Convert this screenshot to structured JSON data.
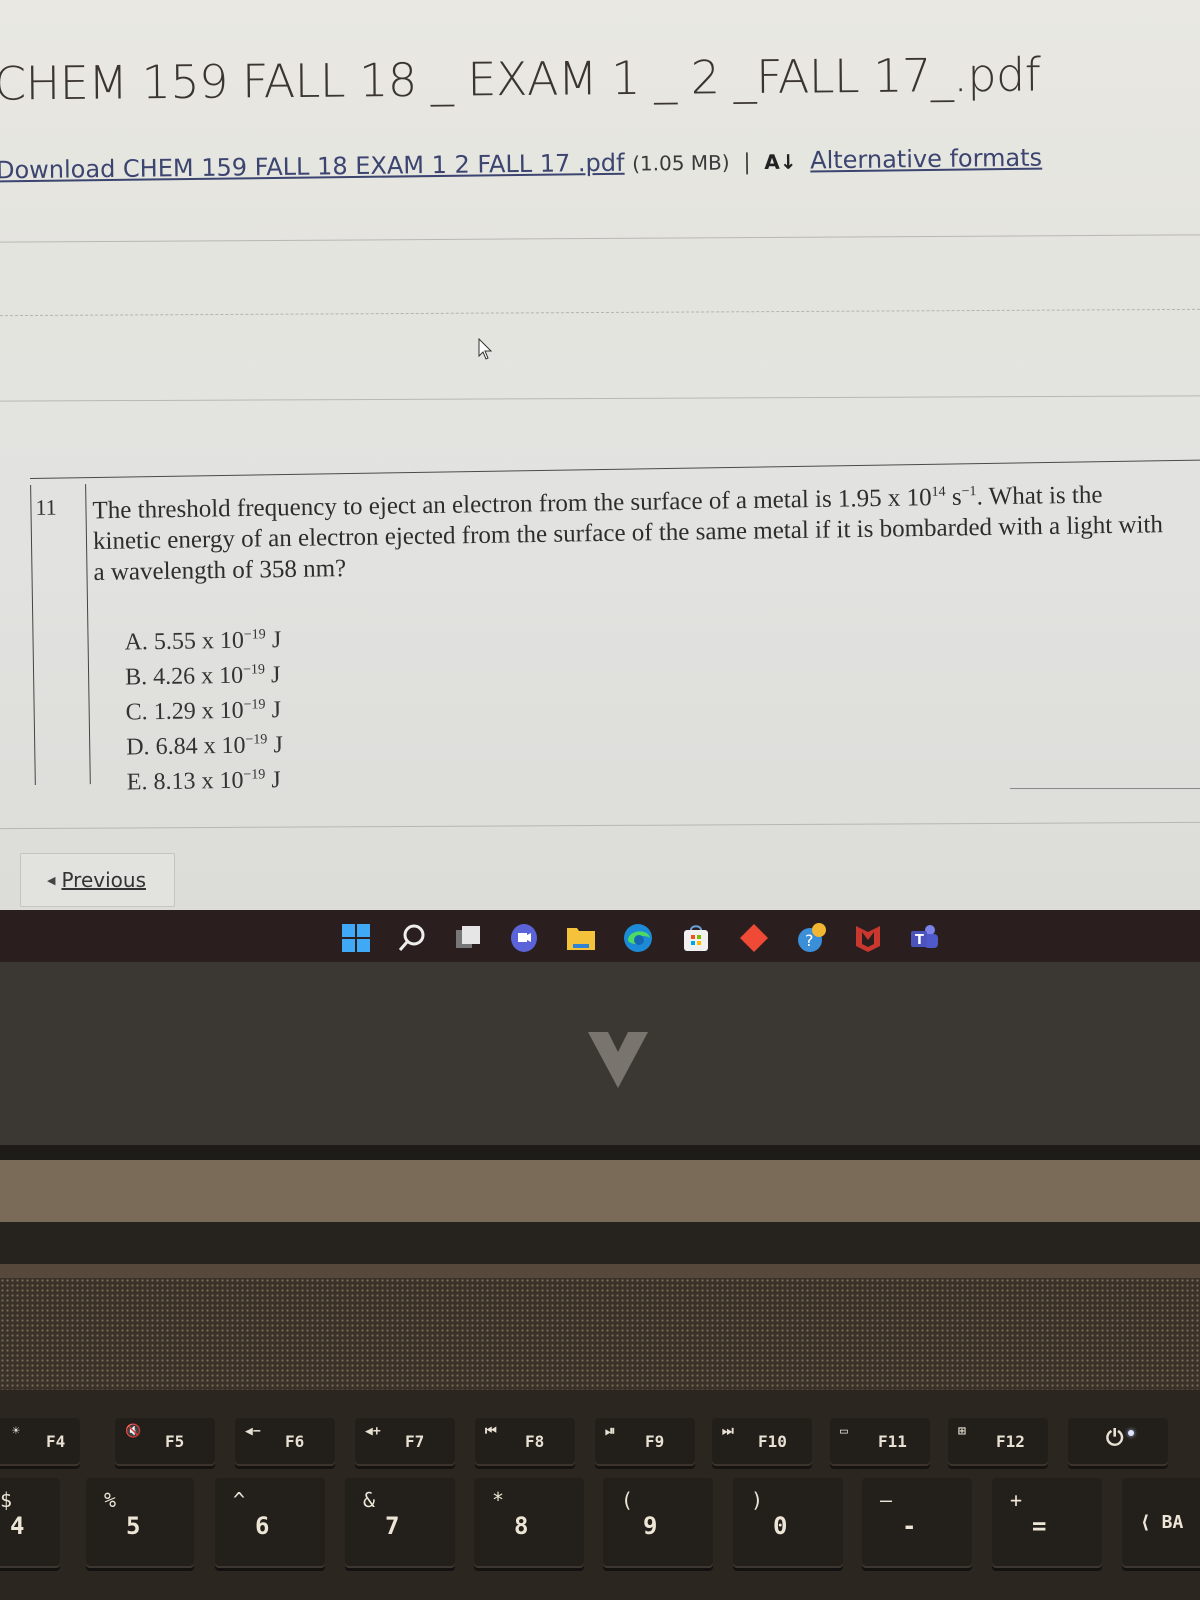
{
  "page": {
    "file_title": "CHEM 159 FALL 18 _ EXAM 1 _ 2 _FALL 17_.pdf",
    "download_link_label": "Download CHEM 159 FALL 18   EXAM 1   2  FALL 17 .pdf",
    "file_size": "(1.05 MB)",
    "separator": "|",
    "alt_formats_icon": "A↓",
    "alt_formats_label": "Alternative formats"
  },
  "question": {
    "number": "11",
    "text_part1": "The threshold frequency to eject an electron from the surface of a metal is 1.95 x 10",
    "exp1": "14",
    "text_part2": " s",
    "exp2": "−1",
    "text_part3": ". What is the kinetic energy of an electron ejected from the surface of the same metal if it is bombarded with a light with a wavelength of 358 nm?",
    "choices": [
      {
        "letter": "A.",
        "mantissa": "5.55 x 10",
        "exponent": "−19",
        "unit": "J"
      },
      {
        "letter": "B.",
        "mantissa": "4.26 x 10",
        "exponent": "−19",
        "unit": "J"
      },
      {
        "letter": "C.",
        "mantissa": "1.29 x 10",
        "exponent": "−19",
        "unit": "J"
      },
      {
        "letter": "D.",
        "mantissa": "6.84 x 10",
        "exponent": "−19",
        "unit": "J"
      },
      {
        "letter": "E.",
        "mantissa": "8.13 x 10",
        "exponent": "−19",
        "unit": "J"
      }
    ]
  },
  "navigation": {
    "previous_icon": "◀",
    "previous_label": "Previous"
  },
  "taskbar": {
    "icons": [
      "windows-start",
      "search",
      "task-view",
      "meet-now",
      "file-explorer",
      "edge",
      "microsoft-store",
      "app-diamond",
      "help-app",
      "mcafee",
      "teams"
    ]
  },
  "keyboard": {
    "function_row": [
      {
        "glyph": "☀",
        "label": "F4"
      },
      {
        "glyph": "🔇",
        "label": "F5"
      },
      {
        "glyph": "◀−",
        "label": "F6"
      },
      {
        "glyph": "◀+",
        "label": "F7"
      },
      {
        "glyph": "⏮",
        "label": "F8"
      },
      {
        "glyph": "⏯",
        "label": "F9"
      },
      {
        "glyph": "⏭",
        "label": "F10"
      },
      {
        "glyph": "▭",
        "label": "F11"
      },
      {
        "glyph": "⊞",
        "label": "F12"
      },
      {
        "glyph": "",
        "label": "⏻"
      }
    ],
    "number_row": [
      {
        "shift": "$",
        "main": "4"
      },
      {
        "shift": "%",
        "main": "5"
      },
      {
        "shift": "^",
        "main": "6"
      },
      {
        "shift": "&",
        "main": "7"
      },
      {
        "shift": "*",
        "main": "8"
      },
      {
        "shift": "(",
        "main": "9"
      },
      {
        "shift": ")",
        "main": "0"
      },
      {
        "shift": "—",
        "main": "-"
      },
      {
        "shift": "+",
        "main": "="
      },
      {
        "shift": "",
        "main": "⟨ BA"
      }
    ]
  }
}
